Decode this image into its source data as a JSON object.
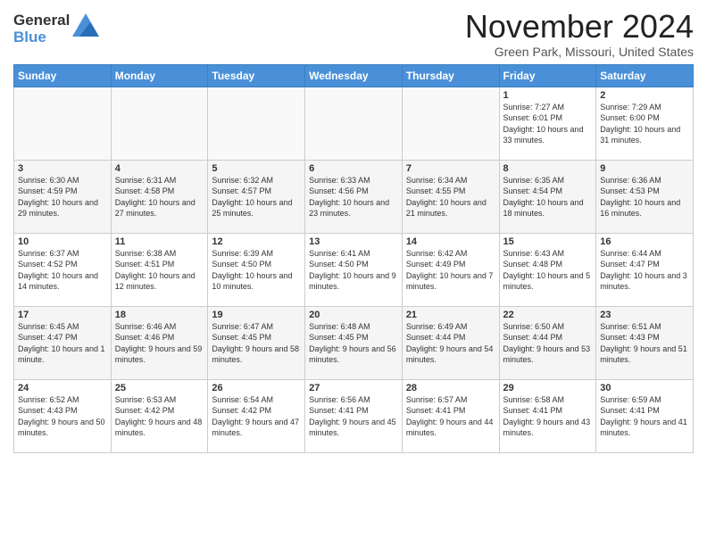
{
  "header": {
    "logo_line1": "General",
    "logo_line2": "Blue",
    "month": "November 2024",
    "location": "Green Park, Missouri, United States"
  },
  "weekdays": [
    "Sunday",
    "Monday",
    "Tuesday",
    "Wednesday",
    "Thursday",
    "Friday",
    "Saturday"
  ],
  "weeks": [
    [
      {
        "day": "",
        "content": ""
      },
      {
        "day": "",
        "content": ""
      },
      {
        "day": "",
        "content": ""
      },
      {
        "day": "",
        "content": ""
      },
      {
        "day": "",
        "content": ""
      },
      {
        "day": "1",
        "content": "Sunrise: 7:27 AM\nSunset: 6:01 PM\nDaylight: 10 hours and 33 minutes."
      },
      {
        "day": "2",
        "content": "Sunrise: 7:29 AM\nSunset: 6:00 PM\nDaylight: 10 hours and 31 minutes."
      }
    ],
    [
      {
        "day": "3",
        "content": "Sunrise: 6:30 AM\nSunset: 4:59 PM\nDaylight: 10 hours and 29 minutes."
      },
      {
        "day": "4",
        "content": "Sunrise: 6:31 AM\nSunset: 4:58 PM\nDaylight: 10 hours and 27 minutes."
      },
      {
        "day": "5",
        "content": "Sunrise: 6:32 AM\nSunset: 4:57 PM\nDaylight: 10 hours and 25 minutes."
      },
      {
        "day": "6",
        "content": "Sunrise: 6:33 AM\nSunset: 4:56 PM\nDaylight: 10 hours and 23 minutes."
      },
      {
        "day": "7",
        "content": "Sunrise: 6:34 AM\nSunset: 4:55 PM\nDaylight: 10 hours and 21 minutes."
      },
      {
        "day": "8",
        "content": "Sunrise: 6:35 AM\nSunset: 4:54 PM\nDaylight: 10 hours and 18 minutes."
      },
      {
        "day": "9",
        "content": "Sunrise: 6:36 AM\nSunset: 4:53 PM\nDaylight: 10 hours and 16 minutes."
      }
    ],
    [
      {
        "day": "10",
        "content": "Sunrise: 6:37 AM\nSunset: 4:52 PM\nDaylight: 10 hours and 14 minutes."
      },
      {
        "day": "11",
        "content": "Sunrise: 6:38 AM\nSunset: 4:51 PM\nDaylight: 10 hours and 12 minutes."
      },
      {
        "day": "12",
        "content": "Sunrise: 6:39 AM\nSunset: 4:50 PM\nDaylight: 10 hours and 10 minutes."
      },
      {
        "day": "13",
        "content": "Sunrise: 6:41 AM\nSunset: 4:50 PM\nDaylight: 10 hours and 9 minutes."
      },
      {
        "day": "14",
        "content": "Sunrise: 6:42 AM\nSunset: 4:49 PM\nDaylight: 10 hours and 7 minutes."
      },
      {
        "day": "15",
        "content": "Sunrise: 6:43 AM\nSunset: 4:48 PM\nDaylight: 10 hours and 5 minutes."
      },
      {
        "day": "16",
        "content": "Sunrise: 6:44 AM\nSunset: 4:47 PM\nDaylight: 10 hours and 3 minutes."
      }
    ],
    [
      {
        "day": "17",
        "content": "Sunrise: 6:45 AM\nSunset: 4:47 PM\nDaylight: 10 hours and 1 minute."
      },
      {
        "day": "18",
        "content": "Sunrise: 6:46 AM\nSunset: 4:46 PM\nDaylight: 9 hours and 59 minutes."
      },
      {
        "day": "19",
        "content": "Sunrise: 6:47 AM\nSunset: 4:45 PM\nDaylight: 9 hours and 58 minutes."
      },
      {
        "day": "20",
        "content": "Sunrise: 6:48 AM\nSunset: 4:45 PM\nDaylight: 9 hours and 56 minutes."
      },
      {
        "day": "21",
        "content": "Sunrise: 6:49 AM\nSunset: 4:44 PM\nDaylight: 9 hours and 54 minutes."
      },
      {
        "day": "22",
        "content": "Sunrise: 6:50 AM\nSunset: 4:44 PM\nDaylight: 9 hours and 53 minutes."
      },
      {
        "day": "23",
        "content": "Sunrise: 6:51 AM\nSunset: 4:43 PM\nDaylight: 9 hours and 51 minutes."
      }
    ],
    [
      {
        "day": "24",
        "content": "Sunrise: 6:52 AM\nSunset: 4:43 PM\nDaylight: 9 hours and 50 minutes."
      },
      {
        "day": "25",
        "content": "Sunrise: 6:53 AM\nSunset: 4:42 PM\nDaylight: 9 hours and 48 minutes."
      },
      {
        "day": "26",
        "content": "Sunrise: 6:54 AM\nSunset: 4:42 PM\nDaylight: 9 hours and 47 minutes."
      },
      {
        "day": "27",
        "content": "Sunrise: 6:56 AM\nSunset: 4:41 PM\nDaylight: 9 hours and 45 minutes."
      },
      {
        "day": "28",
        "content": "Sunrise: 6:57 AM\nSunset: 4:41 PM\nDaylight: 9 hours and 44 minutes."
      },
      {
        "day": "29",
        "content": "Sunrise: 6:58 AM\nSunset: 4:41 PM\nDaylight: 9 hours and 43 minutes."
      },
      {
        "day": "30",
        "content": "Sunrise: 6:59 AM\nSunset: 4:41 PM\nDaylight: 9 hours and 41 minutes."
      }
    ]
  ]
}
